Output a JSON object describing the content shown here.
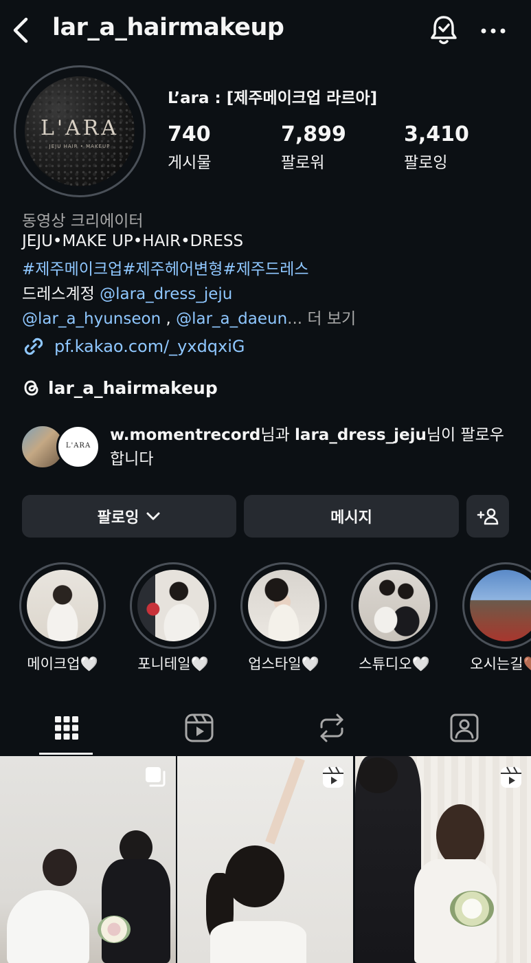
{
  "header": {
    "username": "lar_a_hairmakeup"
  },
  "profile": {
    "avatar_logo": "L'ARA",
    "avatar_subtext": "JEJU HAIR • MAKEUP",
    "display_name": "L’ara : [제주메이크업 라르아]",
    "stats": [
      {
        "value": "740",
        "label": "게시물"
      },
      {
        "value": "7,899",
        "label": "팔로워"
      },
      {
        "value": "3,410",
        "label": "팔로잉"
      }
    ]
  },
  "bio": {
    "category": "동영상 크리에이터",
    "line1": "JEJU•MAKE UP•HAIR•DRESS",
    "hashtags": "#제주메이크업#제주헤어변형#제주드레스",
    "dress_prefix": "드레스계정 ",
    "dress_mention": "@lara_dress_jeju",
    "mention1": "@lar_a_hyunseon",
    "separator": " , ",
    "mention2": "@lar_a_daeun",
    "ellipsis": "...",
    "more": " 더 보기",
    "link": "pf.kakao.com/_yxdqxiG",
    "threads": "lar_a_hairmakeup"
  },
  "followed_by": {
    "mini_logo": "L'ARA",
    "user1": "w.momentrecord",
    "mid": "님과 ",
    "user2": "lara_dress_jeju",
    "suffix": "님이 팔로우합니다"
  },
  "actions": {
    "following": "팔로잉",
    "message": "메시지"
  },
  "highlights": [
    {
      "label": "메이크업",
      "heart": "🤍"
    },
    {
      "label": "포니테일",
      "heart": "🤍"
    },
    {
      "label": "업스타일",
      "heart": "🤍"
    },
    {
      "label": "스튜디오",
      "heart": "🤍"
    },
    {
      "label": "오시는길",
      "heart": "🤎"
    }
  ],
  "tabs": [
    "grid-icon",
    "reels-icon",
    "reposts-icon",
    "tagged-icon"
  ],
  "colors": {
    "background": "#0c1014",
    "link": "#8fc7ff",
    "button": "#262a30",
    "muted": "#a8a8a8"
  }
}
